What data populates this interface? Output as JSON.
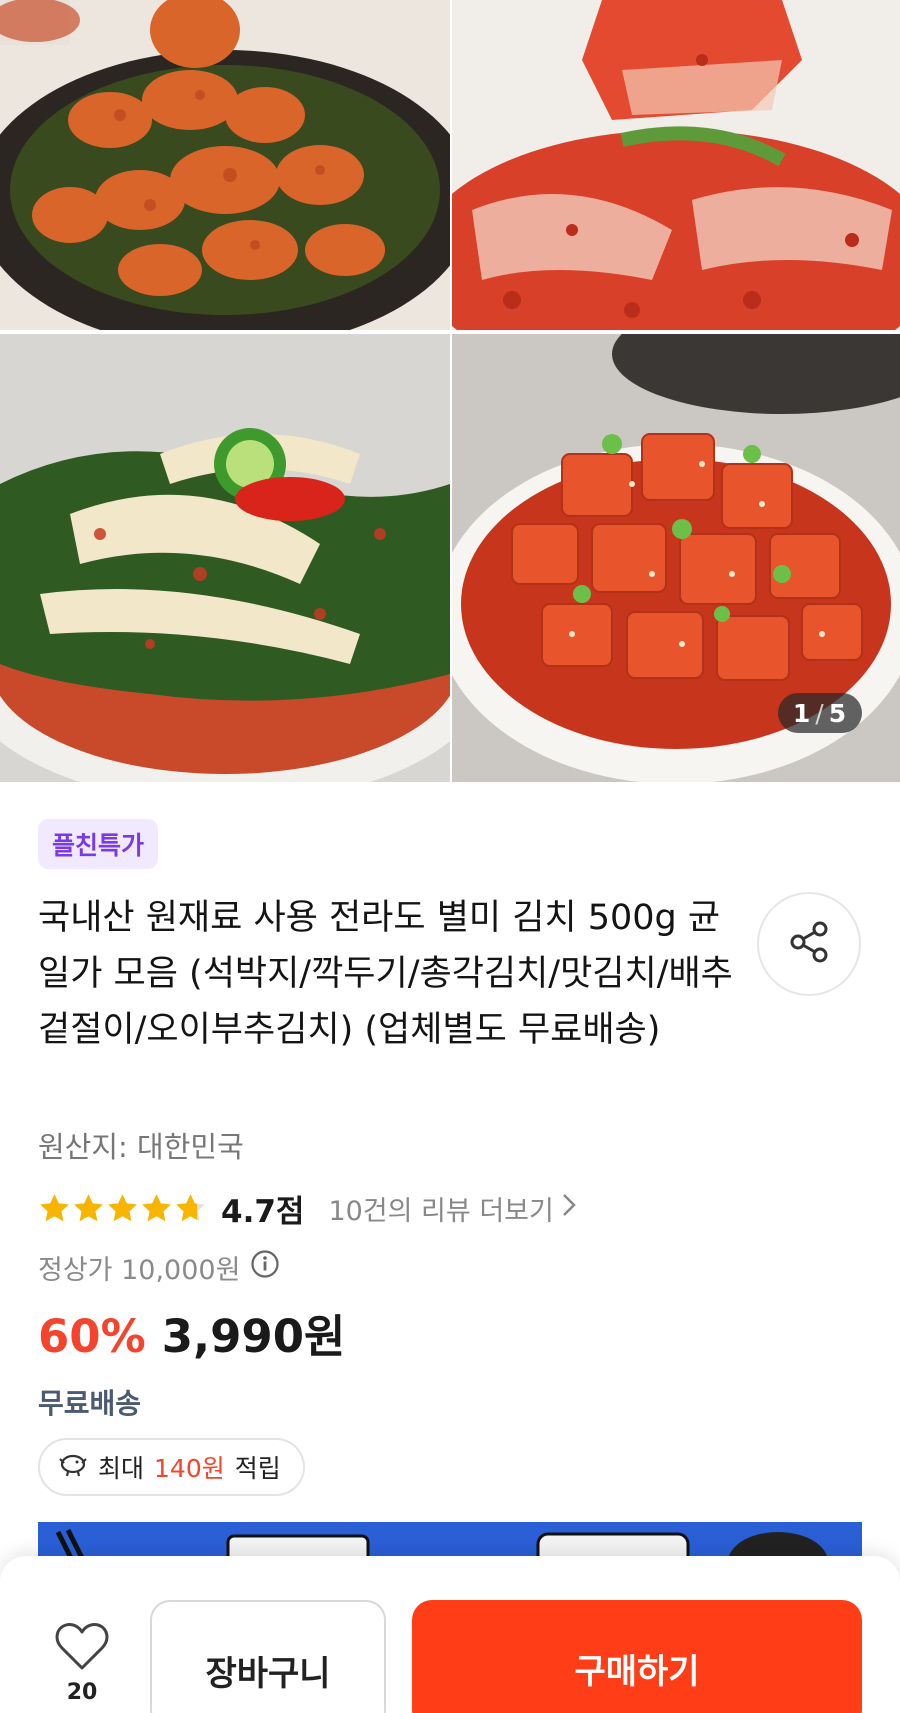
{
  "gallery": {
    "images": [
      {
        "alt": "총각김치"
      },
      {
        "alt": "맛김치"
      },
      {
        "alt": "배추겉절이"
      },
      {
        "alt": "깍두기"
      }
    ],
    "counter_current": "1",
    "counter_sep": "/",
    "counter_total": "5"
  },
  "product": {
    "badge": "플친특가",
    "title": "국내산 원재료 사용 전라도 별미 김치 500g 균일가 모음 (석박지/깍두기/총각김치/맛김치/배추겉절이/오이부추김치) (업체별도 무료배송)",
    "origin": "원산지: 대한민국",
    "rating": {
      "value": 4.7,
      "max": 5,
      "score_text": "4.7점",
      "reviews_text": "10건의 리뷰 더보기"
    },
    "regular_price": "정상가 10,000원",
    "discount": "60%",
    "price": "3,990원",
    "shipping": "무료배송",
    "points": {
      "prefix": "최대",
      "amount": "140원",
      "suffix": "적립"
    }
  },
  "bottom_bar": {
    "like_count": "20",
    "cart_label": "장바구니",
    "buy_label": "구매하기"
  },
  "colors": {
    "accent": "#ff3d17",
    "discount": "#f4442e",
    "badge_bg": "#f1eafe",
    "badge_text": "#7a3be6",
    "star": "#f7b500"
  },
  "icons": {
    "share": "share-icon",
    "info": "info-icon",
    "chevron": "chevron-right-icon",
    "points": "points-icon",
    "heart": "heart-icon"
  }
}
